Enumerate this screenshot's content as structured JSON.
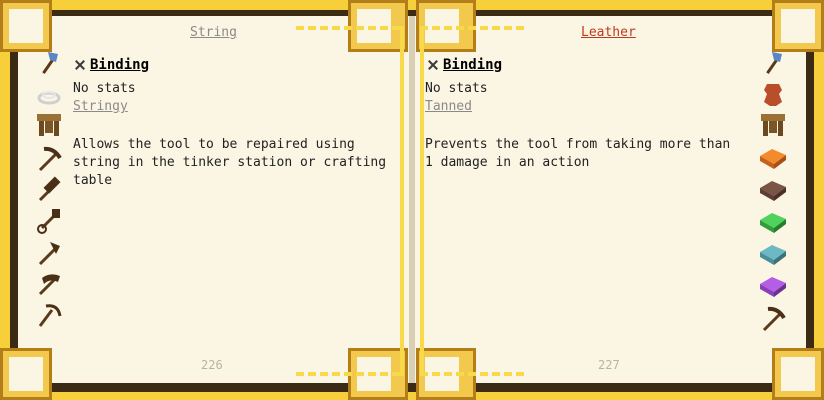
{
  "left_page": {
    "title": "String",
    "entry_name": "Binding",
    "stats": "No stats",
    "trait": "Stringy",
    "description": "Allows the tool to be repaired using string in the tinker station or crafting table",
    "page_number": "226",
    "tool_icons": [
      "axe-icon",
      "string-icon",
      "table-icon",
      "pickaxe-icon",
      "hammer-icon",
      "shovel-icon",
      "mattock-icon",
      "excavator-icon",
      "scythe-icon"
    ]
  },
  "right_page": {
    "title": "Leather",
    "entry_name": "Binding",
    "stats": "No stats",
    "trait": "Tanned",
    "description": "Prevents the tool from taking more than 1 damage in an action",
    "page_number": "227",
    "tool_icons": [
      "axe-icon",
      "leather-icon",
      "table-icon",
      "orange-ingot-icon",
      "brown-ingot-icon",
      "green-ingot-icon",
      "teal-ingot-icon",
      "purple-ingot-icon",
      "pickaxe-icon"
    ]
  },
  "colors": {
    "page": "#fbf5e4",
    "frame": "#3b2a14",
    "accent_gold": "#f7cf3b",
    "title_right": "#c0391b",
    "muted": "#8a8a8a"
  }
}
